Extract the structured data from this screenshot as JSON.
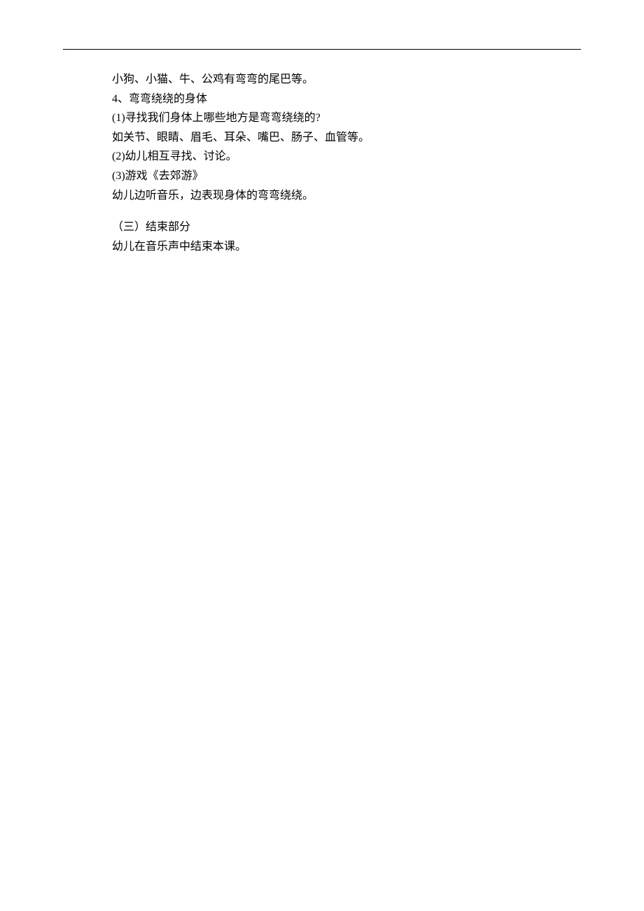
{
  "lines": {
    "l1": "小狗、小猫、牛、公鸡有弯弯的尾巴等。",
    "l2": "4、弯弯绕绕的身体",
    "l3": "(1)寻找我们身体上哪些地方是弯弯绕绕的?",
    "l4": "如关节、眼睛、眉毛、耳朵、嘴巴、肠子、血管等。",
    "l5": "(2)幼儿相互寻找、讨论。",
    "l6": "(3)游戏《去郊游》",
    "l7": "幼儿边听音乐，边表现身体的弯弯绕绕。",
    "l8": "（三）结束部分",
    "l9": "幼儿在音乐声中结束本课。"
  }
}
